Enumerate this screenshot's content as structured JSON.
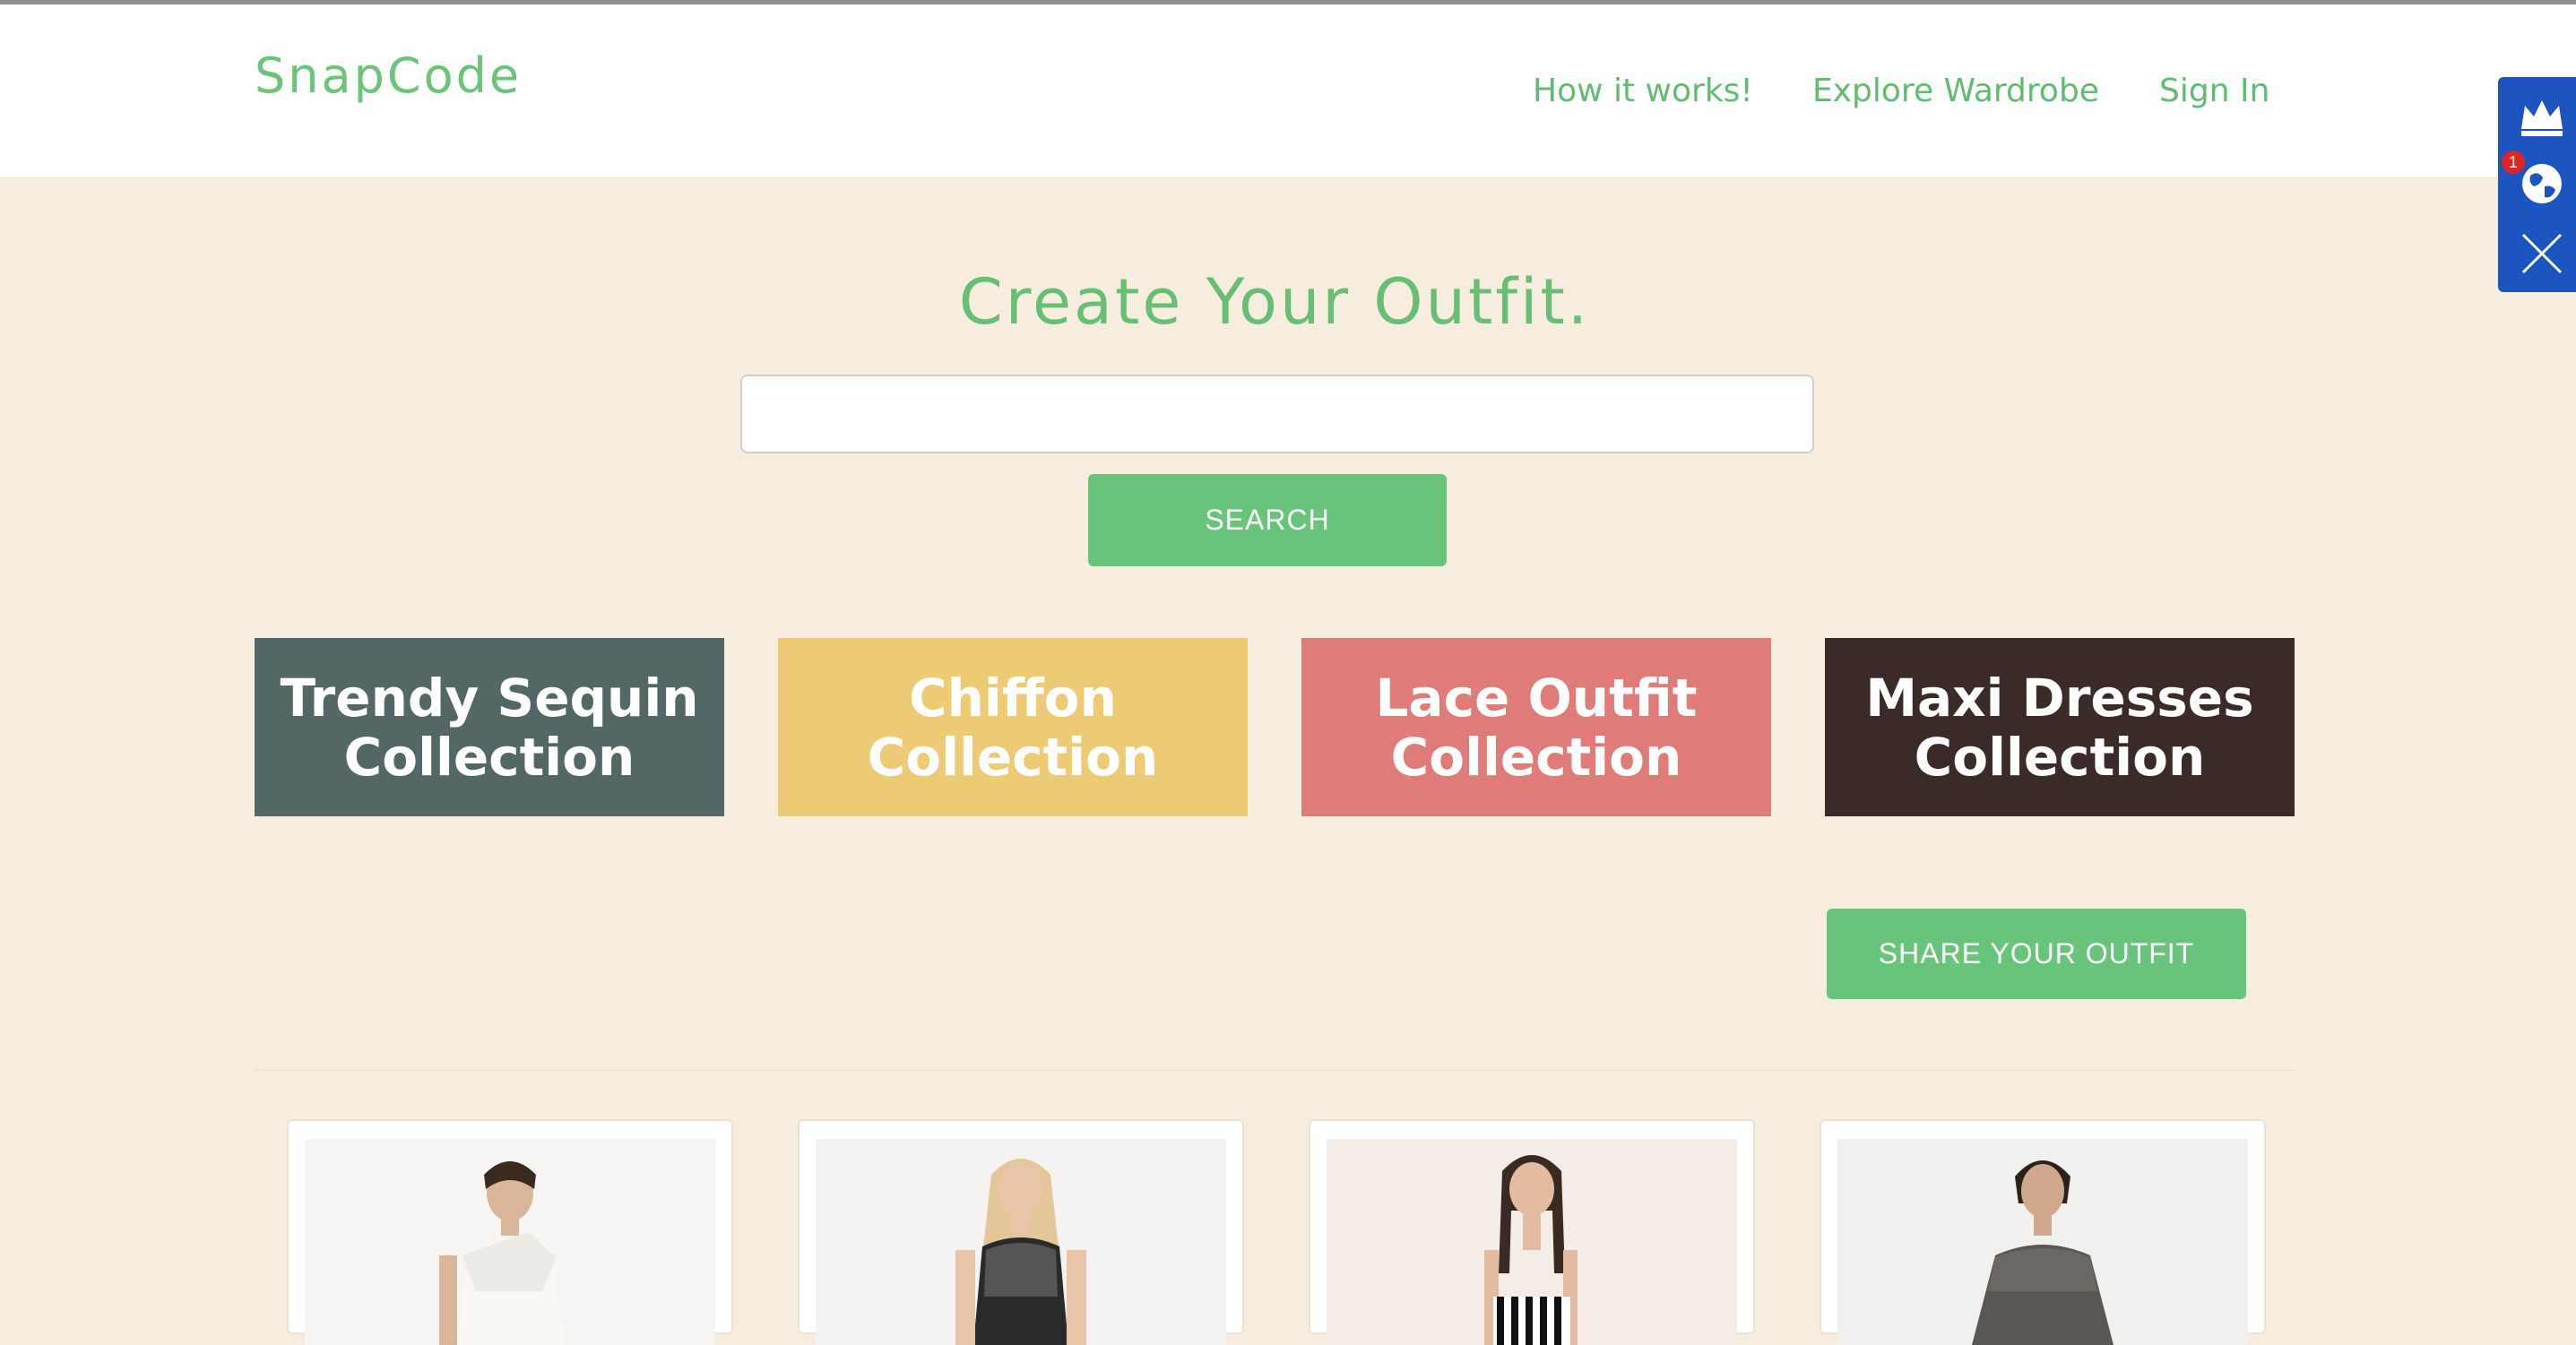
{
  "header": {
    "logo": "SnapCode",
    "nav": {
      "how_it_works": "How it works!",
      "explore": "Explore Wardrobe",
      "sign_in": "Sign In"
    }
  },
  "hero": {
    "title": "Create Your Outfit.",
    "search_value": "",
    "search_button": "SEARCH"
  },
  "collections": [
    {
      "label": "Trendy Sequin Collection",
      "color": "#536866"
    },
    {
      "label": "Chiffon Collection",
      "color": "#edcb75"
    },
    {
      "label": "Lace Outfit Collection",
      "color": "#df7b78"
    },
    {
      "label": "Maxi Dresses Collection",
      "color": "#3b2b28"
    }
  ],
  "share_button": "SHARE YOUR OUTFIT",
  "products": [
    {
      "image": "white one-shoulder dress model"
    },
    {
      "image": "black lace dress model"
    },
    {
      "image": "striped top model"
    },
    {
      "image": "grey knit sweater model"
    }
  ],
  "side_widget": {
    "icons": [
      "crown-icon",
      "globe-icon",
      "close-icon"
    ],
    "badge_count": "1"
  },
  "colors": {
    "accent": "#69c47b",
    "page_background": "#f7eddf",
    "header_background": "#ffffff",
    "widget_blue": "#1d55c0"
  }
}
